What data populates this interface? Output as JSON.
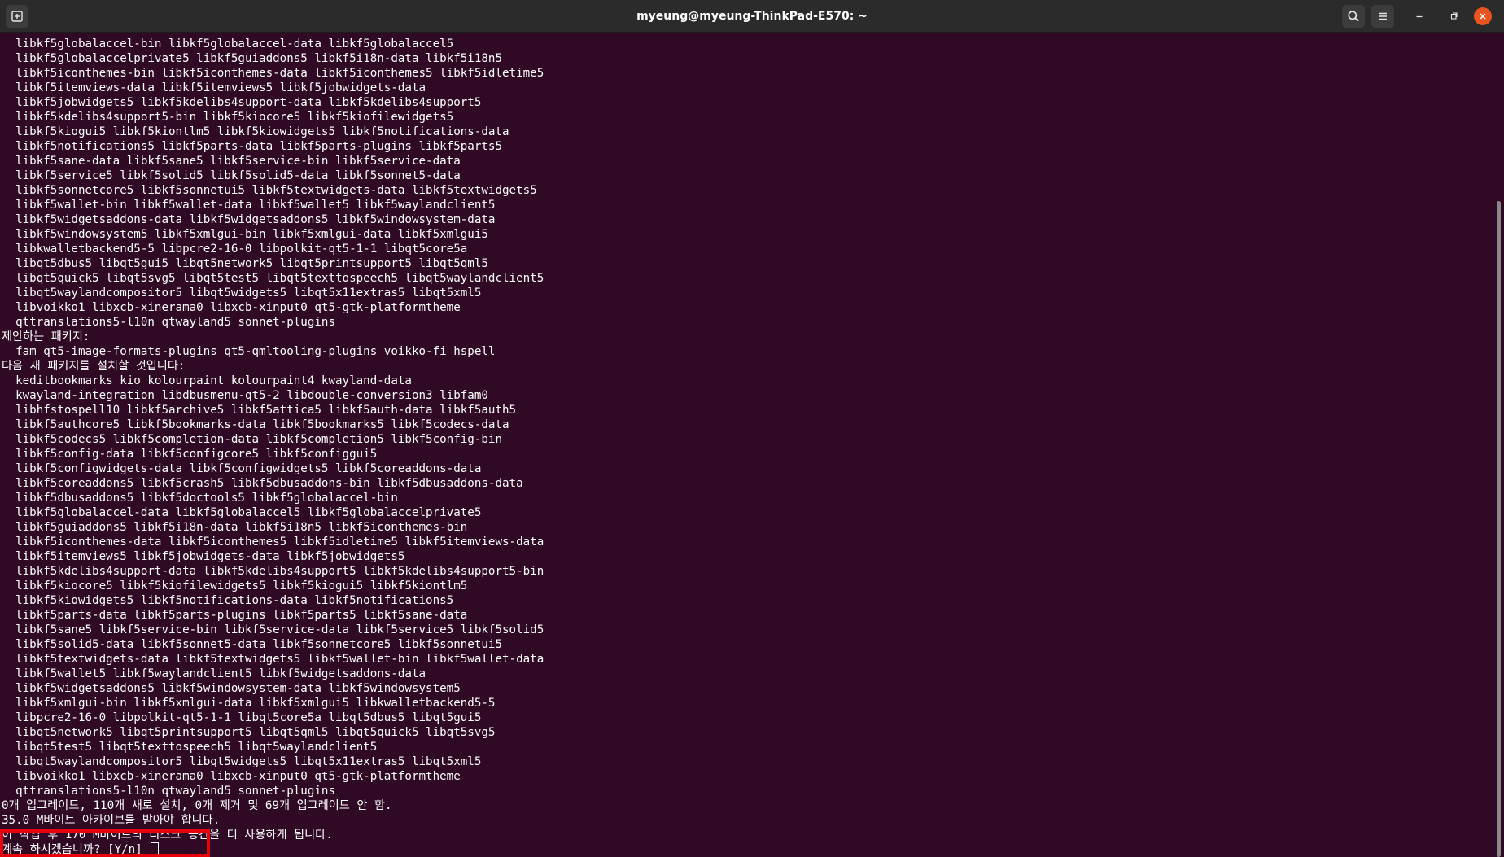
{
  "window": {
    "title": "myeung@myeung-ThinkPad-E570: ~"
  },
  "icons": {
    "new_tab": "new-tab-icon",
    "search": "search-icon",
    "menu": "hamburger-menu-icon",
    "minimize": "minimize-icon",
    "maximize": "maximize-icon",
    "close": "close-icon"
  },
  "colors": {
    "terminal_bg": "#300a24",
    "titlebar_bg": "#2b2b2b",
    "close_button": "#e95420",
    "highlight_box": "#e8000b"
  },
  "terminal": {
    "lines": [
      "  libkf5globalaccel-bin libkf5globalaccel-data libkf5globalaccel5",
      "  libkf5globalaccelprivate5 libkf5guiaddons5 libkf5i18n-data libkf5i18n5",
      "  libkf5iconthemes-bin libkf5iconthemes-data libkf5iconthemes5 libkf5idletime5",
      "  libkf5itemviews-data libkf5itemviews5 libkf5jobwidgets-data",
      "  libkf5jobwidgets5 libkf5kdelibs4support-data libkf5kdelibs4support5",
      "  libkf5kdelibs4support5-bin libkf5kiocore5 libkf5kiofilewidgets5",
      "  libkf5kiogui5 libkf5kiontlm5 libkf5kiowidgets5 libkf5notifications-data",
      "  libkf5notifications5 libkf5parts-data libkf5parts-plugins libkf5parts5",
      "  libkf5sane-data libkf5sane5 libkf5service-bin libkf5service-data",
      "  libkf5service5 libkf5solid5 libkf5solid5-data libkf5sonnet5-data",
      "  libkf5sonnetcore5 libkf5sonnetui5 libkf5textwidgets-data libkf5textwidgets5",
      "  libkf5wallet-bin libkf5wallet-data libkf5wallet5 libkf5waylandclient5",
      "  libkf5widgetsaddons-data libkf5widgetsaddons5 libkf5windowsystem-data",
      "  libkf5windowsystem5 libkf5xmlgui-bin libkf5xmlgui-data libkf5xmlgui5",
      "  libkwalletbackend5-5 libpcre2-16-0 libpolkit-qt5-1-1 libqt5core5a",
      "  libqt5dbus5 libqt5gui5 libqt5network5 libqt5printsupport5 libqt5qml5",
      "  libqt5quick5 libqt5svg5 libqt5test5 libqt5texttospeech5 libqt5waylandclient5",
      "  libqt5waylandcompositor5 libqt5widgets5 libqt5x11extras5 libqt5xml5",
      "  libvoikko1 libxcb-xinerama0 libxcb-xinput0 qt5-gtk-platformtheme",
      "  qttranslations5-l10n qtwayland5 sonnet-plugins",
      "제안하는 패키지:",
      "  fam qt5-image-formats-plugins qt5-qmltooling-plugins voikko-fi hspell",
      "다음 새 패키지를 설치할 것입니다:",
      "  keditbookmarks kio kolourpaint kolourpaint4 kwayland-data",
      "  kwayland-integration libdbusmenu-qt5-2 libdouble-conversion3 libfam0",
      "  libhfstospell10 libkf5archive5 libkf5attica5 libkf5auth-data libkf5auth5",
      "  libkf5authcore5 libkf5bookmarks-data libkf5bookmarks5 libkf5codecs-data",
      "  libkf5codecs5 libkf5completion-data libkf5completion5 libkf5config-bin",
      "  libkf5config-data libkf5configcore5 libkf5configgui5",
      "  libkf5configwidgets-data libkf5configwidgets5 libkf5coreaddons-data",
      "  libkf5coreaddons5 libkf5crash5 libkf5dbusaddons-bin libkf5dbusaddons-data",
      "  libkf5dbusaddons5 libkf5doctools5 libkf5globalaccel-bin",
      "  libkf5globalaccel-data libkf5globalaccel5 libkf5globalaccelprivate5",
      "  libkf5guiaddons5 libkf5i18n-data libkf5i18n5 libkf5iconthemes-bin",
      "  libkf5iconthemes-data libkf5iconthemes5 libkf5idletime5 libkf5itemviews-data",
      "  libkf5itemviews5 libkf5jobwidgets-data libkf5jobwidgets5",
      "  libkf5kdelibs4support-data libkf5kdelibs4support5 libkf5kdelibs4support5-bin",
      "  libkf5kiocore5 libkf5kiofilewidgets5 libkf5kiogui5 libkf5kiontlm5",
      "  libkf5kiowidgets5 libkf5notifications-data libkf5notifications5",
      "  libkf5parts-data libkf5parts-plugins libkf5parts5 libkf5sane-data",
      "  libkf5sane5 libkf5service-bin libkf5service-data libkf5service5 libkf5solid5",
      "  libkf5solid5-data libkf5sonnet5-data libkf5sonnetcore5 libkf5sonnetui5",
      "  libkf5textwidgets-data libkf5textwidgets5 libkf5wallet-bin libkf5wallet-data",
      "  libkf5wallet5 libkf5waylandclient5 libkf5widgetsaddons-data",
      "  libkf5widgetsaddons5 libkf5windowsystem-data libkf5windowsystem5",
      "  libkf5xmlgui-bin libkf5xmlgui-data libkf5xmlgui5 libkwalletbackend5-5",
      "  libpcre2-16-0 libpolkit-qt5-1-1 libqt5core5a libqt5dbus5 libqt5gui5",
      "  libqt5network5 libqt5printsupport5 libqt5qml5 libqt5quick5 libqt5svg5",
      "  libqt5test5 libqt5texttospeech5 libqt5waylandclient5",
      "  libqt5waylandcompositor5 libqt5widgets5 libqt5x11extras5 libqt5xml5",
      "  libvoikko1 libxcb-xinerama0 libxcb-xinput0 qt5-gtk-platformtheme",
      "  qttranslations5-l10n qtwayland5 sonnet-plugins",
      "0개 업그레이드, 110개 새로 설치, 0개 제거 및 69개 업그레이드 안 함.",
      "35.0 M바이트 아카이브를 받아야 합니다.",
      "이 작업 후 170 M바이트의 디스크 공간을 더 사용하게 됩니다."
    ],
    "prompt": "계속 하시겠습니까? [Y/n] "
  }
}
